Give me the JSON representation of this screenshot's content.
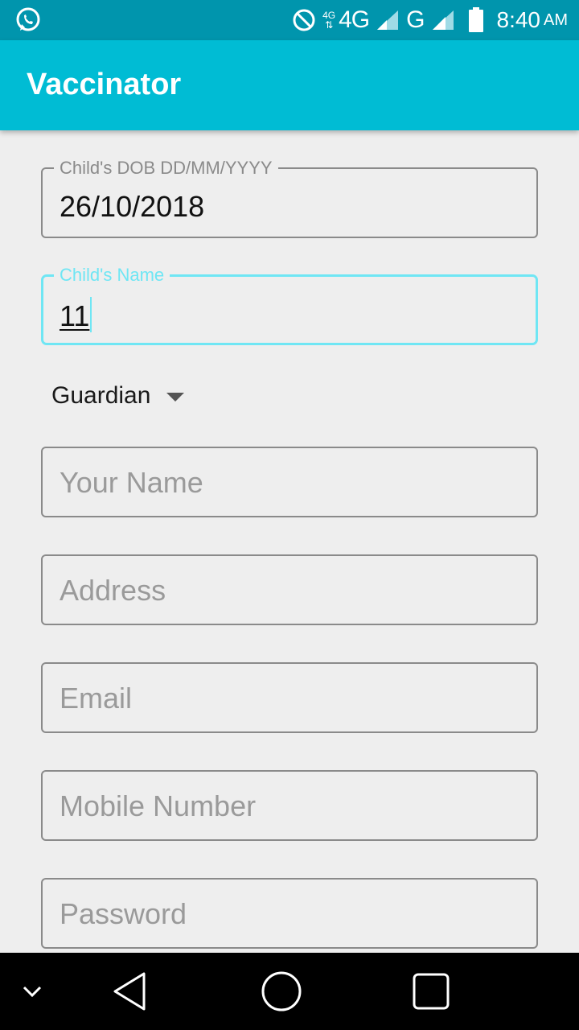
{
  "status_bar": {
    "time": "8:40",
    "ampm": "AM",
    "network_primary": "4G",
    "network_secondary": "G",
    "small_network": "4G",
    "icons": [
      "whatsapp-icon",
      "do-not-disturb-icon",
      "signal-icon",
      "battery-icon"
    ]
  },
  "app": {
    "title": "Vaccinator",
    "accent_color": "#00bcd4",
    "focus_color": "#6fe6f4"
  },
  "form": {
    "dob": {
      "label": "Child's DOB DD/MM/YYYY",
      "value": "26/10/2018"
    },
    "child_name": {
      "label": "Child's Name",
      "value": "11"
    },
    "guardian_select": {
      "selected": "Guardian"
    },
    "your_name": {
      "placeholder": "Your Name"
    },
    "address": {
      "placeholder": "Address"
    },
    "email": {
      "placeholder": "Email"
    },
    "mobile": {
      "placeholder": "Mobile Number"
    },
    "password": {
      "placeholder": "Password"
    }
  },
  "nav": {
    "icons": [
      "hide-keyboard-icon",
      "back-icon",
      "home-icon",
      "recents-icon"
    ]
  }
}
